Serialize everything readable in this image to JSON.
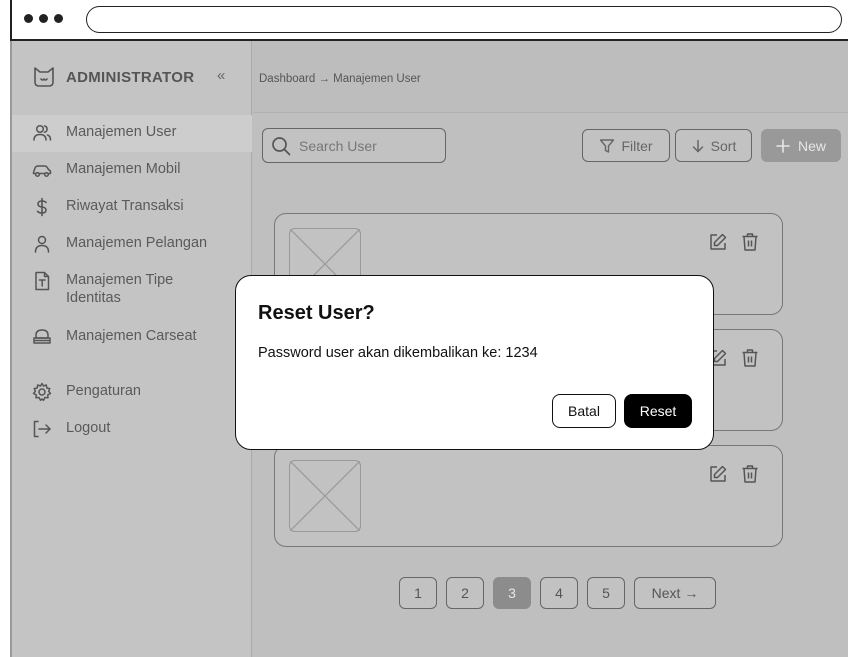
{
  "sidebar": {
    "brand": "ADMINISTRATOR",
    "collapse_glyph": "«",
    "items": [
      {
        "label": "Manajemen User",
        "icon": "users-icon",
        "active": true
      },
      {
        "label": "Manajemen Mobil",
        "icon": "car-icon"
      },
      {
        "label": "Riwayat Transaksi",
        "icon": "dollar-icon"
      },
      {
        "label": "Manajemen Pelangan",
        "icon": "user-icon"
      },
      {
        "label": "Manajemen Tipe Identitas",
        "icon": "id-card-icon"
      },
      {
        "label": "Manajemen Carseat",
        "icon": "carseat-icon"
      },
      {
        "label": "Pengaturan",
        "icon": "gear-icon"
      },
      {
        "label": "Logout",
        "icon": "logout-icon"
      }
    ]
  },
  "header": {
    "breadcrumb": "Dashboard → Manajemen User"
  },
  "toolbar": {
    "search_placeholder": "Search User",
    "filter_label": "Filter",
    "sort_label": "Sort",
    "new_label": "New"
  },
  "pagination": {
    "pages": [
      "1",
      "2",
      "3",
      "4",
      "5"
    ],
    "active": "3",
    "next_label": "Next →"
  },
  "modal": {
    "title": "Reset User?",
    "message": "Password user akan dikembalikan ke: 1234",
    "cancel_label": "Batal",
    "confirm_label": "Reset"
  },
  "colors": {
    "overlay": "#bfbfbf",
    "primary": "#000000",
    "active_page": "#8c8c8c"
  }
}
